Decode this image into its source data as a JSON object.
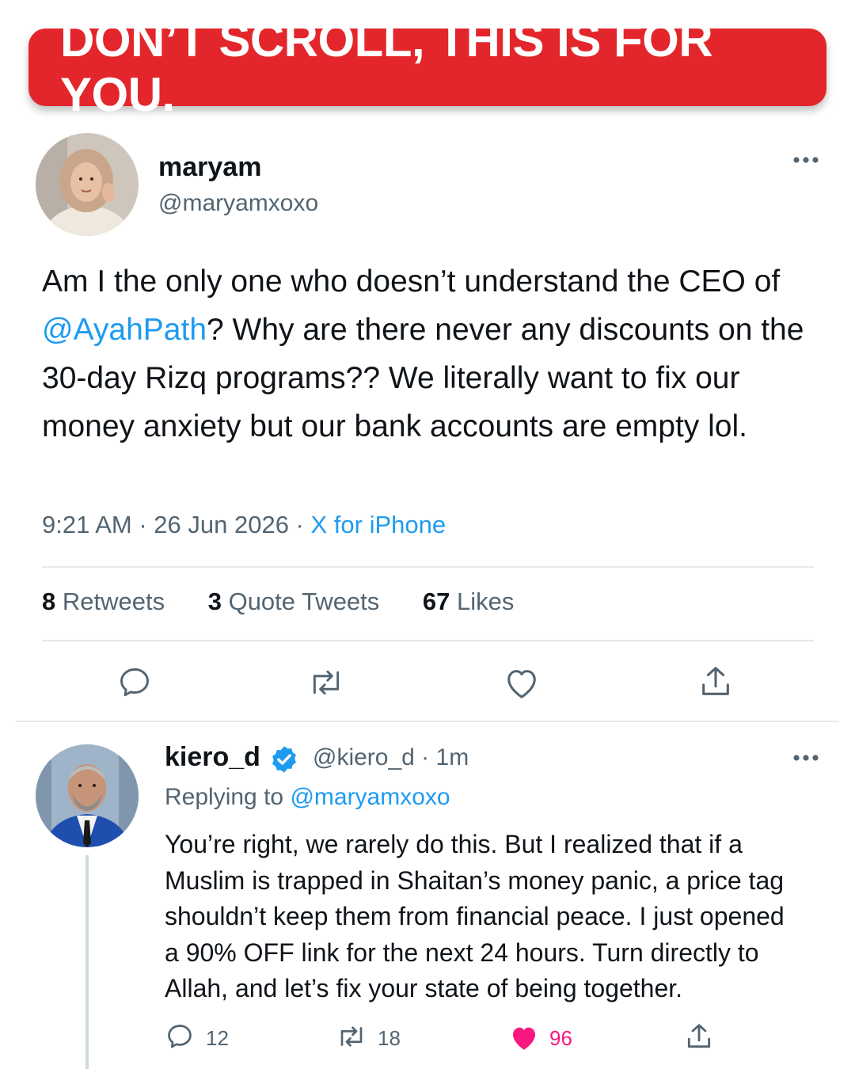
{
  "banner": {
    "text": "DON’T SCROLL, THIS IS FOR YOU."
  },
  "tweet": {
    "author": {
      "name": "maryam",
      "handle": "@maryamxoxo"
    },
    "text_before": "Am I the only one who doesn’t understand the CEO of ",
    "mention": "@AyahPath",
    "text_after": "? Why are there never any discounts on the 30-day Rizq programs?? We literally want to fix our money anxiety but our bank accounts are empty lol.",
    "meta_time": "9:21 AM · 26 Jun 2026 · ",
    "meta_source": "X for iPhone",
    "stats": {
      "retweets_count": "8",
      "retweets_label": " Retweets",
      "quotes_count": "3",
      "quotes_label": " Quote Tweets",
      "likes_count": "67",
      "likes_label": " Likes"
    },
    "icons": [
      "reply-icon",
      "retweet-icon",
      "like-icon",
      "share-icon"
    ]
  },
  "reply": {
    "author": {
      "name": "kiero_d",
      "handle": "@kiero_d · 1m",
      "verified": true
    },
    "replying_prefix": "Replying to ",
    "replying_to": "@maryamxoxo",
    "text": "You’re right, we rarely do this. But I realized that if a Muslim is trapped in Shaitan’s money panic, a price tag shouldn’t keep them from financial peace. I just opened a 90% OFF link for the next 24 hours. Turn directly to Allah, and let’s fix your state of being together.",
    "counts": {
      "replies": "12",
      "retweets": "18",
      "likes": "96"
    },
    "liked": true
  },
  "colors": {
    "accent": "#1d9bf0",
    "banner": "#e3262b",
    "like": "#f91880",
    "secondary": "#536471"
  }
}
